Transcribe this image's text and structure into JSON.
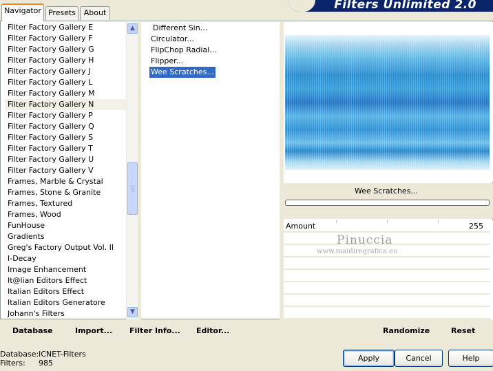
{
  "tabs": [
    {
      "label": "Navigator",
      "active": true
    },
    {
      "label": "Presets",
      "active": false
    },
    {
      "label": "About",
      "active": false
    }
  ],
  "app_title": "Filters Unlimited 2.0",
  "categories": [
    "Filter Factory Gallery E",
    "Filter Factory Gallery F",
    "Filter Factory Gallery G",
    "Filter Factory Gallery H",
    "Filter Factory Gallery J",
    "Filter Factory Gallery L",
    "Filter Factory Gallery M",
    "Filter Factory Gallery N",
    "Filter Factory Gallery P",
    "Filter Factory Gallery Q",
    "Filter Factory Gallery S",
    "Filter Factory Gallery T",
    "Filter Factory Gallery U",
    "Filter Factory Gallery V",
    "Frames, Marble & Crystal",
    "Frames, Stone & Granite",
    "Frames, Textured",
    "Frames, Wood",
    "FunHouse",
    "Gradients",
    "Greg's Factory Output Vol. II",
    "I-Decay",
    "Image Enhancement",
    "It@lian Editors Effect",
    "Italian Editors Effect",
    "Italian Editors Generatore",
    "Johann's Filters"
  ],
  "selected_category": "Filter Factory Gallery N",
  "filters": [
    "Different Sin...",
    "Circulator...",
    "FlipChop Radial...",
    "Flipper...",
    "Wee Scratches..."
  ],
  "selected_filter": "Wee Scratches...",
  "preview": {
    "effect_name": "Wee Scratches...",
    "progress": 0
  },
  "parameters": [
    {
      "label": "Amount",
      "value": "255"
    }
  ],
  "watermark": {
    "name": "Pinuccia",
    "url": "www.maidiregrafica.eu"
  },
  "toolbar": {
    "database": "Database",
    "import": "Import...",
    "filter_info": "Filter Info...",
    "editor": "Editor...",
    "randomize": "Randomize",
    "reset": "Reset"
  },
  "status": {
    "database_label": "Database:",
    "database_value": "ICNET-Filters",
    "filters_label": "Filters:",
    "filters_value": "985"
  },
  "buttons": {
    "apply": "Apply",
    "cancel": "Cancel",
    "help": "Help"
  },
  "colors": {
    "selection": "#316ac5",
    "banner": "#0a246a",
    "face": "#ece9d8"
  }
}
